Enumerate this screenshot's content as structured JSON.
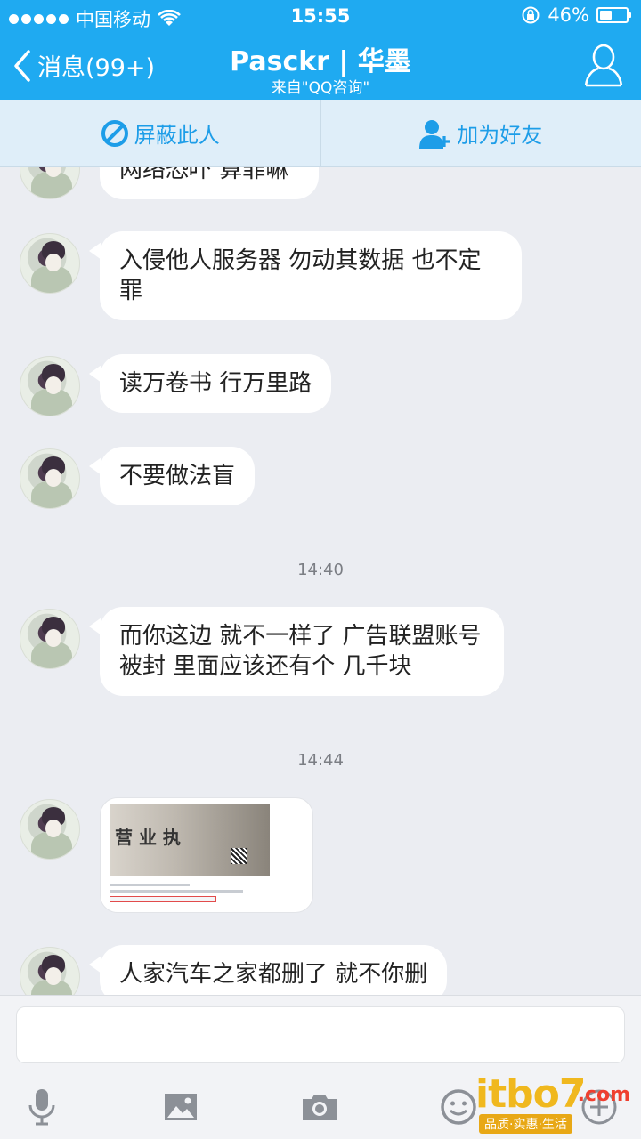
{
  "status_bar": {
    "carrier": "中国移动",
    "time": "15:55",
    "battery": "46%",
    "battery_level": 0.46
  },
  "nav": {
    "back_label": "消息(99+)",
    "title": "Pasckr | 华墨",
    "subtitle": "来自\"QQ咨询\""
  },
  "actions": {
    "block_label": "屏蔽此人",
    "add_friend_label": "加为好友"
  },
  "messages": [
    {
      "text": "网络恐吓 算罪嘛"
    },
    {
      "text": "入侵他人服务器 勿动其数据 也不定罪"
    },
    {
      "text": "读万卷书 行万里路"
    },
    {
      "text": "不要做法盲"
    },
    {
      "timestamp": "14:40"
    },
    {
      "text": "而你这边 就不一样了  广告联盟账号被封 里面应该还有个 几千块"
    },
    {
      "timestamp": "14:44"
    },
    {
      "image": "business-license-screenshot",
      "image_caption": "营 业 执"
    },
    {
      "text": "人家汽车之家都删了 就不你删"
    }
  ],
  "input": {
    "value": ""
  },
  "toolbar": {
    "icons": [
      "microphone-icon",
      "image-icon",
      "camera-icon",
      "emoji-icon",
      "plus-icon"
    ]
  },
  "watermark": {
    "brand": "itbo7",
    "suffix": ".com",
    "slogan": "品质·实惠·生活"
  },
  "colors": {
    "header": "#1faaf1",
    "action_text": "#1d9de8",
    "chat_bg": "#ebedf2"
  }
}
